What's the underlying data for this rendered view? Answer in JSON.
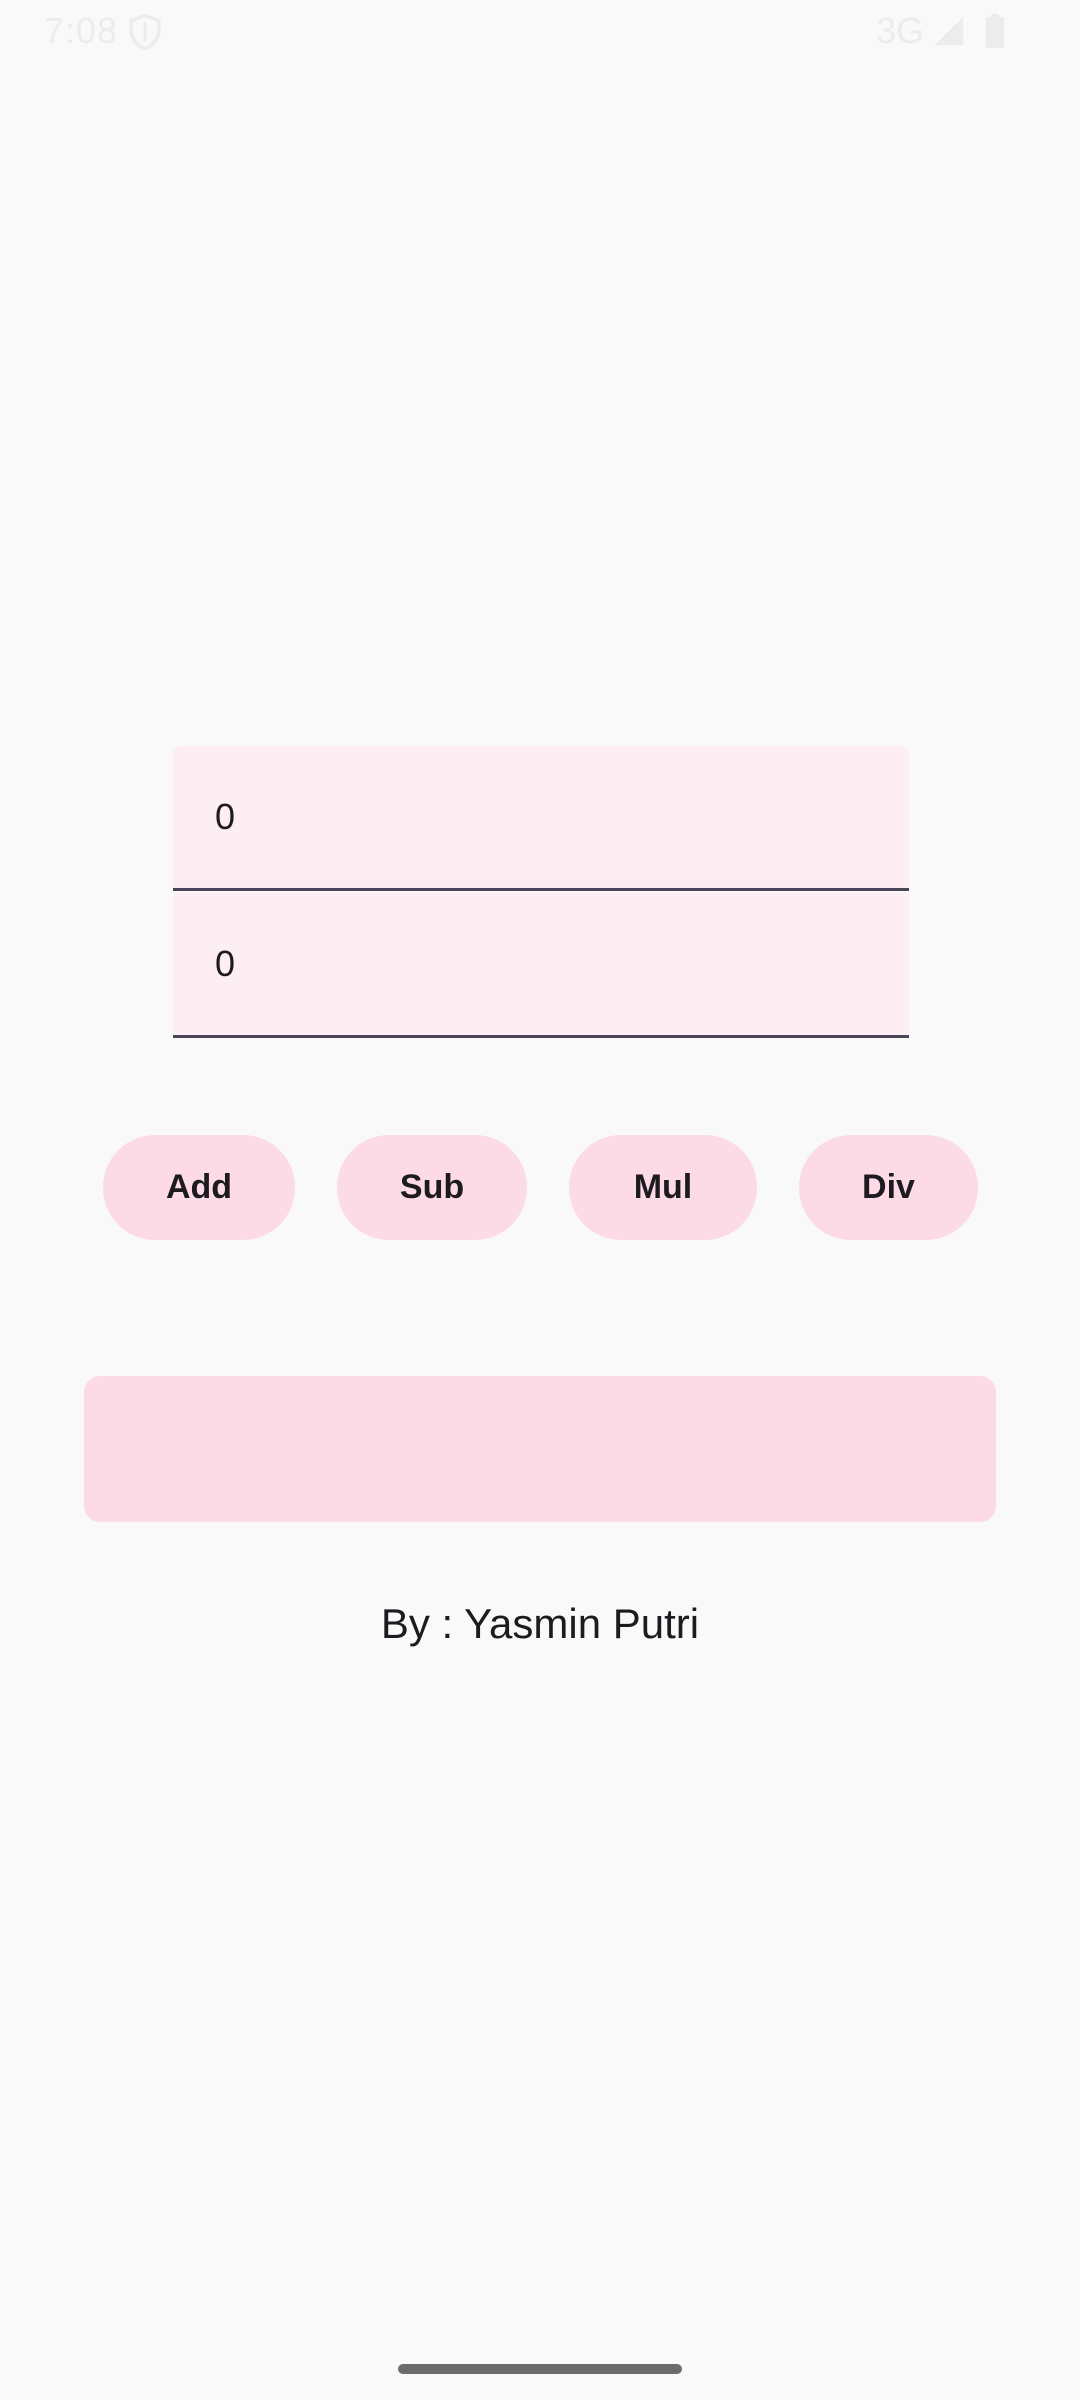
{
  "status_bar": {
    "time": "7:08",
    "network": "3G",
    "icons": [
      "shield-icon",
      "signal-icon",
      "battery-icon"
    ]
  },
  "inputs": {
    "first_value": "0",
    "second_value": "0"
  },
  "buttons": {
    "add": "Add",
    "sub": "Sub",
    "mul": "Mul",
    "div": "Div"
  },
  "result": {
    "text": ""
  },
  "footer": {
    "author": "By : Yasmin Putri"
  },
  "colors": {
    "background": "#f9f9f9",
    "input_fill": "#fdeef3",
    "button_fill": "#fddbe6",
    "text": "#1d1b20"
  }
}
